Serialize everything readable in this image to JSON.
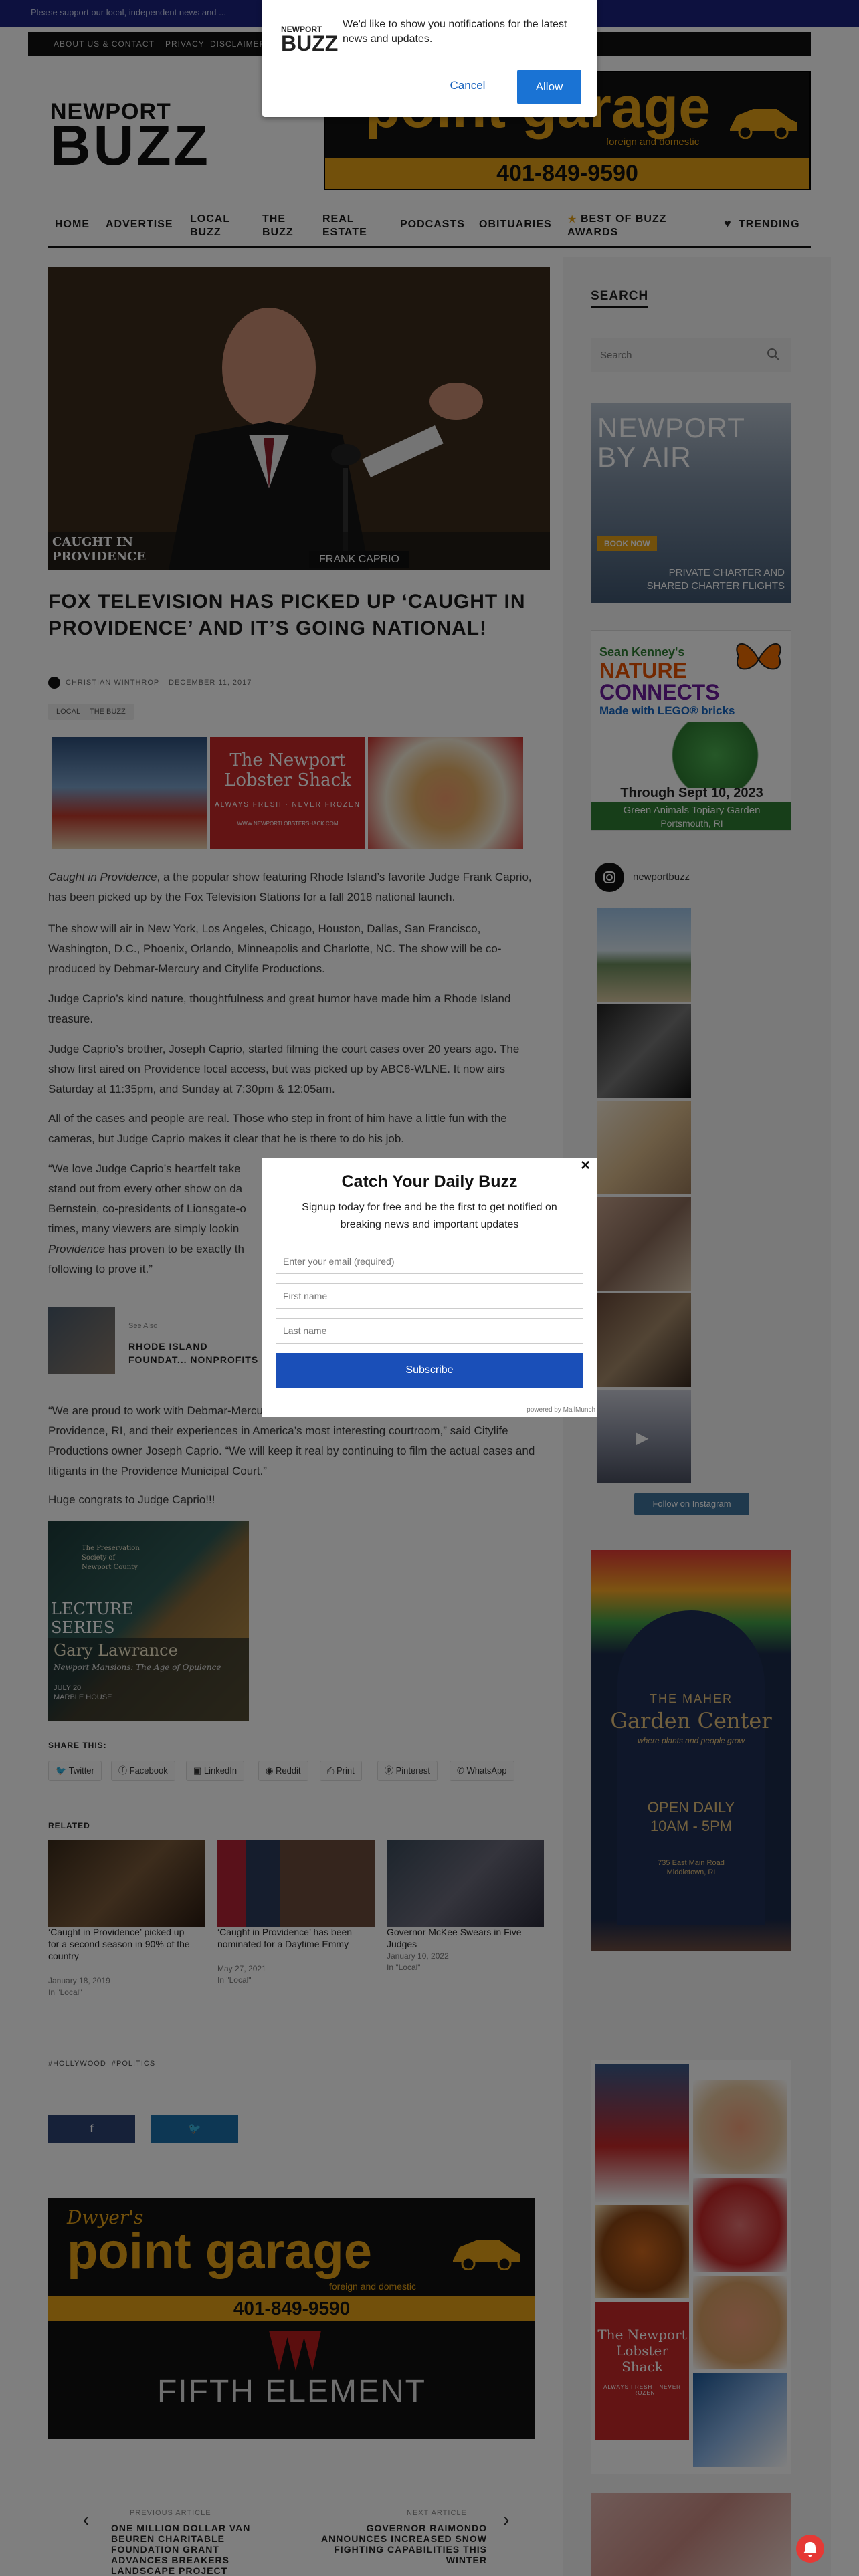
{
  "top_banner": {
    "text": "Please support our local, independent news and ..."
  },
  "top_bar": {
    "links": [
      "ABOUT US & CONTACT",
      "PRIVACY",
      "DISCLAIMER"
    ]
  },
  "logo": {
    "line1": "NEWPORT",
    "line2": "BUZZ"
  },
  "header_ad": {
    "line1": "point garage",
    "line2": "foreign and domestic",
    "phone": "401-849-9590"
  },
  "nav": {
    "items": [
      "HOME",
      "ADVERTISE",
      "LOCAL BUZZ",
      "THE BUZZ",
      "REAL ESTATE",
      "PODCASTS",
      "OBITUARIES",
      "BEST OF BUZZ AWARDS"
    ],
    "trending": "TRENDING"
  },
  "hero": {
    "caption_left": "CAUGHT IN PROVIDENCE",
    "caption_right": "FRANK CAPRIO"
  },
  "article": {
    "title": "FOX TELEVISION HAS PICKED UP ‘CAUGHT IN PROVIDENCE’ AND IT’S GOING NATIONAL!",
    "author": "CHRISTIAN WINTHROP",
    "date": "DECEMBER 11, 2017",
    "tags": [
      "LOCAL",
      "THE BUZZ"
    ],
    "p1_italic": "Caught in Providence",
    "p1": ", a the popular show featuring Rhode Island’s favorite Judge Frank Caprio, has been picked up by the Fox Television Stations for a fall 2018 national launch.",
    "p2": "The show will air in New York, Los Angeles, Chicago, Houston, Dallas, San Francisco, Washington, D.C., Phoenix, Orlando, Minneapolis and Charlotte, NC. The show will be co-produced by Debmar-Mercury and Citylife Productions.",
    "p3": "Judge Caprio’s kind nature, thoughtfulness and great humor have made him a Rhode Island treasure.",
    "p4": "Judge Caprio’s brother, Joseph Caprio, started filming the court cases over 20 years ago. The show first aired on Providence local access, but was picked up by ABC6-WLNE. It now airs Saturday at 11:35pm, and Sunday at 7:30pm & 12:05am.",
    "p5": "All of the cases and people are real. Those who step in front of him have a little fun with the cameras, but Judge Caprio makes it clear that he is there to do his job.",
    "p6_l1": "“We love Judge Caprio’s heartfelt take",
    "p6_l2": "stand out from every other show on da",
    "p6_l3": "Bernstein, co-presidents of Lionsgate-o",
    "p6_l4": "times, many viewers are simply lookin",
    "p6_l5a": "Providence",
    "p6_l5b": " has proven to be exactly th",
    "p6_l6": "following to prove it.”",
    "see_also": "See Also",
    "see_also_title": "RHODE ISLAND FOUNDAT... NONPROFITS",
    "p7": "“We are proud to work with Debmar-Mercury to showcase the wonderful people of the City of Providence, RI, and their experiences in America’s most interesting courtroom,” said Citylife Productions owner Joseph Caprio. “We will keep it real by continuing to film the actual cases and litigants in the Providence Municipal Court.”",
    "p8": "Huge congrats to Judge Caprio!!!"
  },
  "lobster_ad": {
    "title1": "The Newport",
    "title2": "Lobster Shack",
    "sub": "ALWAYS FRESH · NEVER FROZEN",
    "url": "WWW.NEWPORTLOBSTERSHACK.COM"
  },
  "lecture_ad": {
    "org1": "The Preservation",
    "org2": "Society of",
    "org3": "Newport County",
    "series1": "LECTURE",
    "series2": "SERIES",
    "speaker": "Gary Lawrance",
    "topic": "Newport Mansions: The Age of Opulence",
    "date": "JULY 20",
    "venue": "MARBLE HOUSE"
  },
  "share": {
    "label": "SHARE THIS:",
    "buttons": [
      "Twitter",
      "Facebook",
      "LinkedIn",
      "Reddit",
      "Print",
      "Pinterest",
      "WhatsApp"
    ]
  },
  "related": {
    "label": "RELATED",
    "items": [
      {
        "title": "‘Caught in Providence’ picked up for a second season in 90% of the country",
        "date": "January 18, 2019",
        "cat": "In \"Local\""
      },
      {
        "title": "‘Caught in Providence’ has been nominated for a Daytime Emmy",
        "date": "May 27, 2021",
        "cat": "In \"Local\""
      },
      {
        "title": "Governor McKee Swears in Five Judges",
        "date": "January 10, 2022",
        "cat": "In \"Local\""
      }
    ]
  },
  "post_tags": "#HOLLYWOOD  #POLITICS",
  "bottom_ad": {
    "brand": "Dwyer's",
    "line1": "point garage",
    "line2": "foreign and domestic",
    "phone": "401-849-9590",
    "fifth": "FIFTH ELEMENT"
  },
  "post_nav": {
    "prev_label": "PREVIOUS ARTICLE",
    "prev_title": "ONE MILLION DOLLAR VAN BEUREN CHARITABLE FOUNDATION GRANT ADVANCES BREAKERS LANDSCAPE PROJECT",
    "next_label": "NEXT ARTICLE",
    "next_title": "GOVERNOR RAIMONDO ANNOUNCES INCREASED SNOW FIGHTING CAPABILITIES THIS WINTER"
  },
  "sidebar": {
    "search_title": "SEARCH",
    "search_placeholder": "Search",
    "air_ad": {
      "l1": "NEWPORT",
      "l2": "BY AIR",
      "cta": "BOOK NOW",
      "t1": "PRIVATE CHARTER AND",
      "t2": "SHARED CHARTER FLIGHTS"
    },
    "nature_ad": {
      "l1": "Sean Kenney's",
      "l2": "NATURE",
      "l3": "CONNECTS",
      "l4": "Made with LEGO® bricks",
      "date": "Through Sept 10, 2023",
      "place": "Green Animals Topiary Garden",
      "town": "Portsmouth, RI"
    },
    "instagram_handle": "newportbuzz",
    "follow_label": "Follow on Instagram",
    "maher_ad": {
      "l1": "THE MAHER",
      "l2": "Garden Center",
      "l3": "where plants and people grow",
      "l4": "OPEN DAILY",
      "l5": "10AM - 5PM",
      "addr1": "735 East Main Road",
      "addr2": "Middletown, RI"
    }
  },
  "notification": {
    "text": "We'd like to show you notifications for the latest news and updates.",
    "cancel": "Cancel",
    "allow": "Allow",
    "brand1": "NEWPORT",
    "brand2": "BUZZ"
  },
  "popup": {
    "title": "Catch Your Daily Buzz",
    "desc": "Signup today for free and be the first to get notified on breaking news and important updates",
    "email_ph": "Enter your email (required)",
    "first_ph": "First name",
    "last_ph": "Last name",
    "submit": "Subscribe",
    "powered": "powered by MailMunch",
    "close": "×"
  },
  "colors": {
    "accent": "#e5a017",
    "blue": "#1155cc",
    "dark": "#1b1b1b"
  }
}
